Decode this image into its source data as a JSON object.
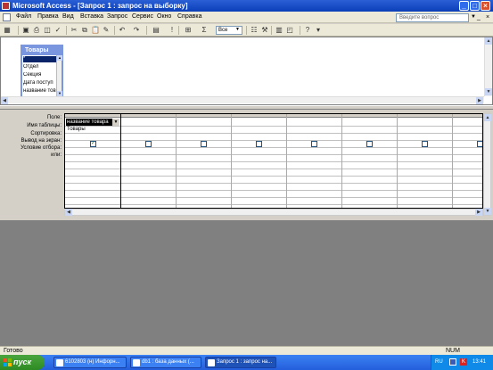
{
  "window": {
    "title": "Microsoft Access - [Запрос 1 : запрос на выборку]"
  },
  "menu": {
    "items": [
      "Файл",
      "Правка",
      "Вид",
      "Вставка",
      "Запрос",
      "Сервис",
      "Окно",
      "Справка"
    ],
    "help_placeholder": "Введите вопрос"
  },
  "toolbar": {
    "top_values": "Все"
  },
  "table_box": {
    "title": "Товары",
    "fields": [
      "*",
      "Отдел",
      "Секция",
      "Дата поступ",
      "название тов"
    ]
  },
  "grid": {
    "row_labels": [
      "Поле:",
      "Имя таблицы:",
      "Сортировка:",
      "Вывод на экран:",
      "Условие отбора:",
      "или:"
    ],
    "field_value": "название товара",
    "table_value": "Товары",
    "show_first_checked": true
  },
  "statusbar": {
    "text": "Готово",
    "num": "NUM"
  },
  "taskbar": {
    "start": "пуск",
    "tasks": [
      "6102803 (н) Инфорн...",
      "db1 : база данных (...",
      "Запрос 1 : запрос на..."
    ],
    "lang": "RU",
    "clock": "13:41"
  },
  "colors": {
    "titlebar": "#0b3fb8",
    "table_header": "#7a96df",
    "taskbar": "#245edb",
    "start": "#2e8b24"
  }
}
